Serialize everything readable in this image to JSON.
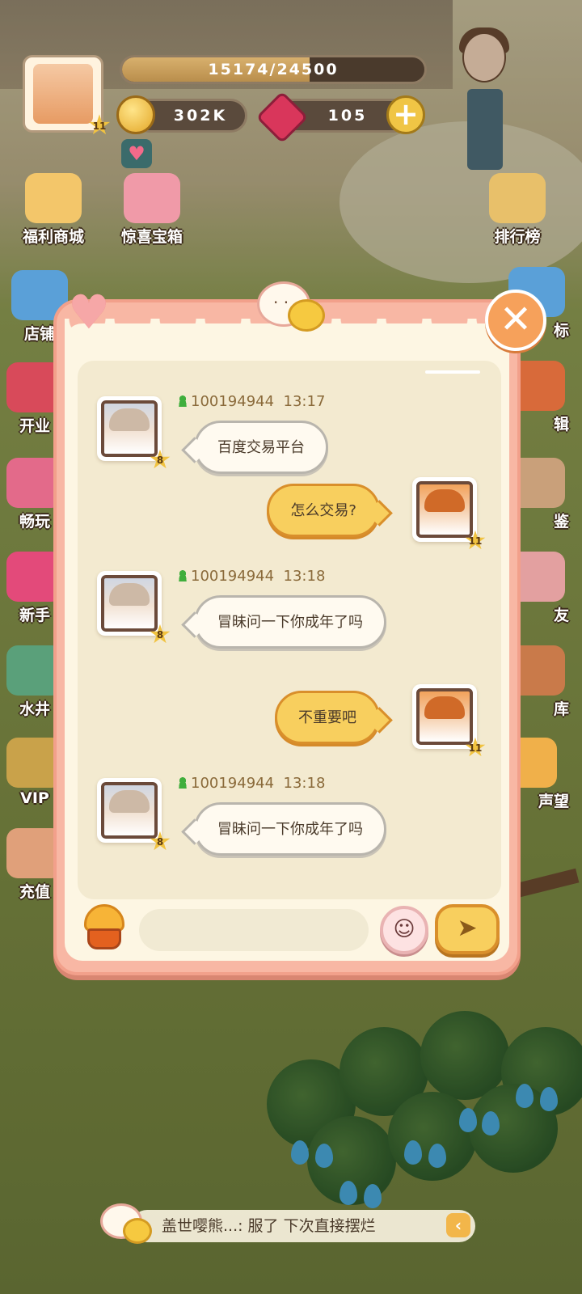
{
  "hud": {
    "player_level": "11",
    "xp_text": "15174/24500",
    "xp_fraction": 0.619,
    "coins": "302K",
    "gems": "105"
  },
  "left_menu": [
    {
      "label": "福利商城",
      "icon": "gift-shop-icon"
    },
    {
      "label": "惊喜宝箱",
      "icon": "treasure-chest-icon"
    },
    {
      "label": "店铺",
      "icon": "shop-icon"
    },
    {
      "label": "开业",
      "icon": "opening-icon"
    },
    {
      "label": "畅玩",
      "icon": "play-icon"
    },
    {
      "label": "新手",
      "icon": "newbie-icon"
    },
    {
      "label": "水井",
      "icon": "well-icon"
    },
    {
      "label": "VIP",
      "icon": "vip-icon"
    },
    {
      "label": "充值",
      "icon": "recharge-icon"
    }
  ],
  "right_menu": [
    {
      "label": "排行榜",
      "icon": "ranking-icon"
    },
    {
      "label": "标",
      "icon": "calendar-icon"
    },
    {
      "label": "辑",
      "icon": "album-icon"
    },
    {
      "label": "鉴",
      "icon": "handbook-icon"
    },
    {
      "label": "友",
      "icon": "friends-icon"
    },
    {
      "label": "库",
      "icon": "warehouse-icon"
    },
    {
      "label": "声望",
      "icon": "reputation-icon"
    }
  ],
  "chat": {
    "messages": [
      {
        "side": "left",
        "user_id": "100194944",
        "time": "13:17",
        "text": "百度交易平台",
        "level": "8"
      },
      {
        "side": "right",
        "text": "怎么交易?",
        "level": "11"
      },
      {
        "side": "left",
        "user_id": "100194944",
        "time": "13:18",
        "text": "冒昧问一下你成年了吗",
        "level": "8"
      },
      {
        "side": "right",
        "text": "不重要吧",
        "level": "11"
      },
      {
        "side": "left",
        "user_id": "100194944",
        "time": "13:18",
        "text": "冒昧问一下你成年了吗",
        "level": "8"
      }
    ],
    "input_value": "",
    "input_placeholder": ""
  },
  "ticker": {
    "text": "盖世嘤熊...:  服了 下次直接摆烂"
  },
  "colors": {
    "dialog_frame": "#f8b7a4",
    "bubble_self": "#f8cf5e",
    "bubble_other": "#fffaf0",
    "user_icon": "#3fae3c"
  }
}
